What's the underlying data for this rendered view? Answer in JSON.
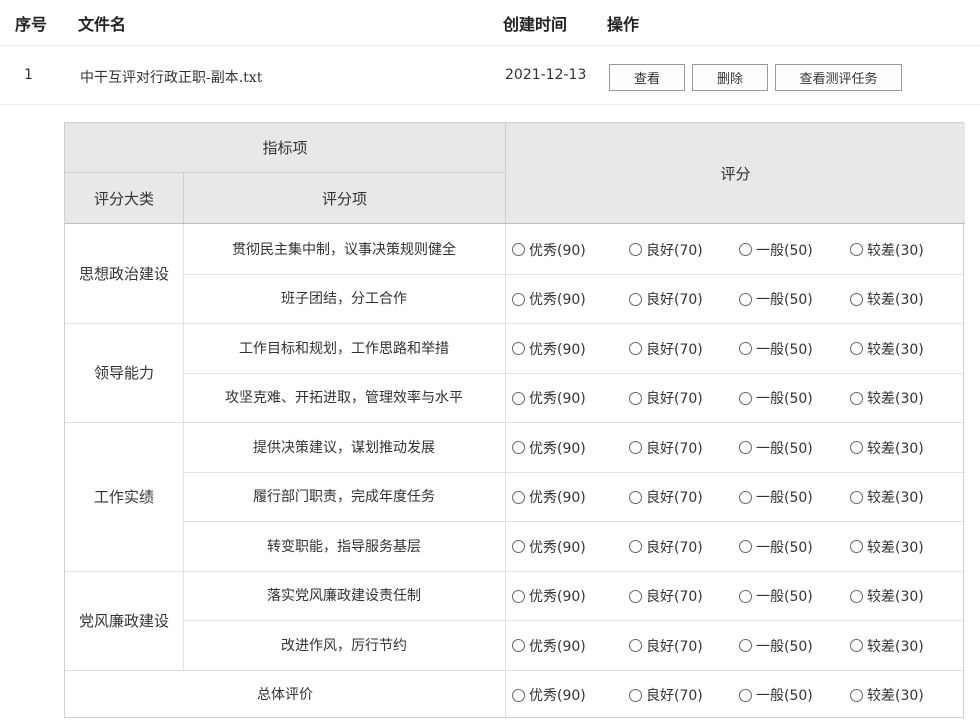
{
  "file_table": {
    "columns": [
      "序号",
      "文件名",
      "创建时间",
      "操作"
    ],
    "rows": [
      {
        "index": "1",
        "filename": "中干互评对行政正职-副本.txt",
        "created": "2021-12-13",
        "actions": [
          "查看",
          "删除",
          "查看测评任务"
        ]
      }
    ]
  },
  "eval_table": {
    "header": {
      "indicator": "指标项",
      "category": "评分大类",
      "item": "评分项",
      "score": "评分"
    },
    "options": [
      "优秀(90)",
      "良好(70)",
      "一般(50)",
      "较差(30)"
    ],
    "categories": [
      {
        "name": "思想政治建设",
        "items": [
          "贯彻民主集中制，议事决策规则健全",
          "班子团结，分工合作"
        ]
      },
      {
        "name": "领导能力",
        "items": [
          "工作目标和规划，工作思路和举措",
          "攻坚克难、开拓进取，管理效率与水平"
        ]
      },
      {
        "name": "工作实绩",
        "items": [
          "提供决策建议，谋划推动发展",
          "履行部门职责，完成年度任务",
          "转变职能，指导服务基层"
        ]
      },
      {
        "name": "党风廉政建设",
        "items": [
          "落实党风廉政建设责任制",
          "改进作风，厉行节约"
        ]
      }
    ],
    "overall": "总体评价"
  }
}
